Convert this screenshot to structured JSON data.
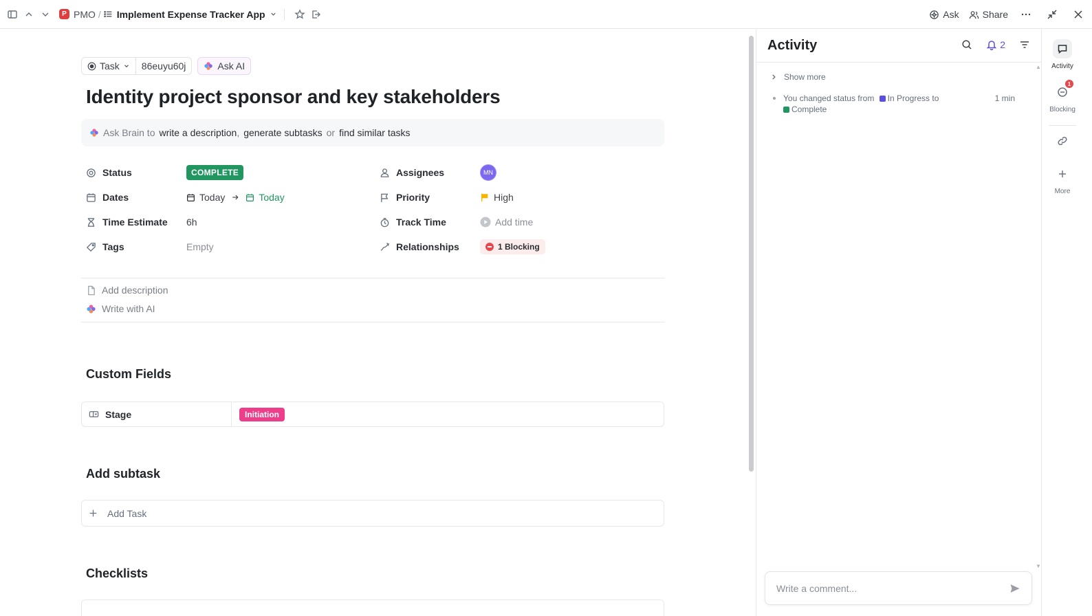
{
  "topbar": {
    "space_initial": "P",
    "space_name": "PMO",
    "separator": "/",
    "list_name": "Implement Expense Tracker App",
    "ask_label": "Ask",
    "share_label": "Share"
  },
  "task": {
    "type_label": "Task",
    "task_id": "86euyu60j",
    "ask_ai_label": "Ask AI",
    "title": "Identity project sponsor and key stakeholders"
  },
  "brain": {
    "prefix": "Ask Brain to",
    "action1": "write a description",
    "comma": ",",
    "action2": "generate subtasks",
    "or": "or",
    "action3": "find similar tasks"
  },
  "fields": {
    "status_label": "Status",
    "status_value": "COMPLETE",
    "dates_label": "Dates",
    "start_date": "Today",
    "due_date": "Today",
    "time_estimate_label": "Time Estimate",
    "time_estimate_value": "6h",
    "tags_label": "Tags",
    "tags_value": "Empty",
    "assignees_label": "Assignees",
    "assignee_initials": "MN",
    "priority_label": "Priority",
    "priority_value": "High",
    "track_time_label": "Track Time",
    "track_time_value": "Add time",
    "relationships_label": "Relationships",
    "relationships_value": "1 Blocking"
  },
  "description": {
    "add_description": "Add description",
    "write_with_ai": "Write with AI"
  },
  "custom_fields": {
    "title": "Custom Fields",
    "stage_label": "Stage",
    "stage_value": "Initiation"
  },
  "subtask": {
    "title": "Add subtask",
    "add_task": "Add Task"
  },
  "checklists": {
    "title": "Checklists"
  },
  "activity": {
    "title": "Activity",
    "notification_count": "2",
    "show_more": "Show more",
    "entry_text": "You changed status from",
    "from_status": "In Progress",
    "to_word": "to",
    "to_status": "Complete",
    "entry_time": "1 min",
    "comment_placeholder": "Write a comment..."
  },
  "rail": {
    "activity_label": "Activity",
    "blocking_label": "Blocking",
    "blocking_count": "1",
    "more_label": "More"
  },
  "colors": {
    "status_complete": "#229660",
    "in_progress": "#5b4fe0",
    "stage_initiation": "#ee3e8b",
    "priority_high": "#f5b400",
    "blocking": "#e5484d",
    "avatar": "#7b68ee"
  }
}
